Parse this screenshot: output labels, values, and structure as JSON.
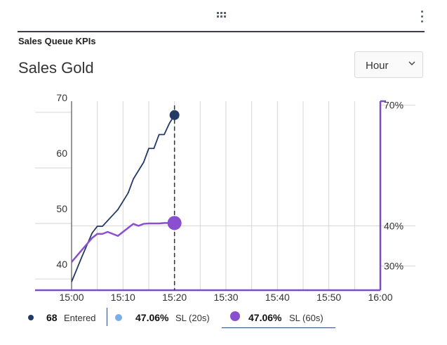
{
  "widget": {
    "title": "Sales Queue KPIs",
    "queue_name": "Sales Gold"
  },
  "interval_select": {
    "value": "Hour"
  },
  "icons": {
    "drag": "drag-handle-icon",
    "menu": "more-vertical-icon",
    "select": "chevron-down-icon"
  },
  "colors": {
    "entered": "#233a66",
    "sl20": "#7aaeea",
    "sl60": "#8a4fcf",
    "axis": "#7a4fc6"
  },
  "legend": [
    {
      "value": "68",
      "label": "Entered",
      "color": "#233a66"
    },
    {
      "value": "47.06%",
      "label": "SL (20s)",
      "color": "#7aaeea"
    },
    {
      "value": "47.06%",
      "label": "SL (60s)",
      "color": "#8a4fcf"
    }
  ],
  "chart_data": {
    "type": "line",
    "x_ticks": [
      "15:00",
      "15:10",
      "15:20",
      "15:30",
      "15:40",
      "15:50",
      "16:00"
    ],
    "y_left": {
      "ticks": [
        "40",
        "50",
        "60",
        "70"
      ],
      "range": [
        38,
        72
      ]
    },
    "y_right": {
      "ticks": [
        "30%",
        "40%",
        "70%"
      ],
      "range": [
        24,
        71
      ]
    },
    "current_time": "15:20",
    "series": [
      {
        "name": "Entered",
        "axis": "left",
        "points": [
          [
            0,
            39.5
          ],
          [
            2,
            44
          ],
          [
            4,
            48.3
          ],
          [
            5,
            49.5
          ],
          [
            6,
            49.5
          ],
          [
            7,
            50.5
          ],
          [
            8,
            51.5
          ],
          [
            9,
            52.5
          ],
          [
            10,
            54
          ],
          [
            11,
            55.5
          ],
          [
            12,
            58
          ],
          [
            13,
            59.5
          ],
          [
            14,
            61
          ],
          [
            15,
            63.5
          ],
          [
            16,
            63.5
          ],
          [
            17,
            66
          ],
          [
            18,
            66
          ],
          [
            19,
            68
          ],
          [
            20,
            69.5
          ]
        ]
      },
      {
        "name": "SL (60s)",
        "axis": "right",
        "points": [
          [
            0,
            31
          ],
          [
            2,
            34
          ],
          [
            4,
            37
          ],
          [
            5,
            38
          ],
          [
            6,
            38
          ],
          [
            7,
            38.5
          ],
          [
            8,
            38
          ],
          [
            9,
            37.5
          ],
          [
            10,
            38.5
          ],
          [
            11,
            39.5
          ],
          [
            12,
            40.5
          ],
          [
            13,
            40
          ],
          [
            14,
            40.5
          ],
          [
            15,
            40.6
          ],
          [
            16,
            40.6
          ],
          [
            17,
            40.6
          ],
          [
            18,
            40.7
          ],
          [
            19,
            40.7
          ],
          [
            20,
            40.7
          ]
        ]
      }
    ],
    "grid": true
  }
}
